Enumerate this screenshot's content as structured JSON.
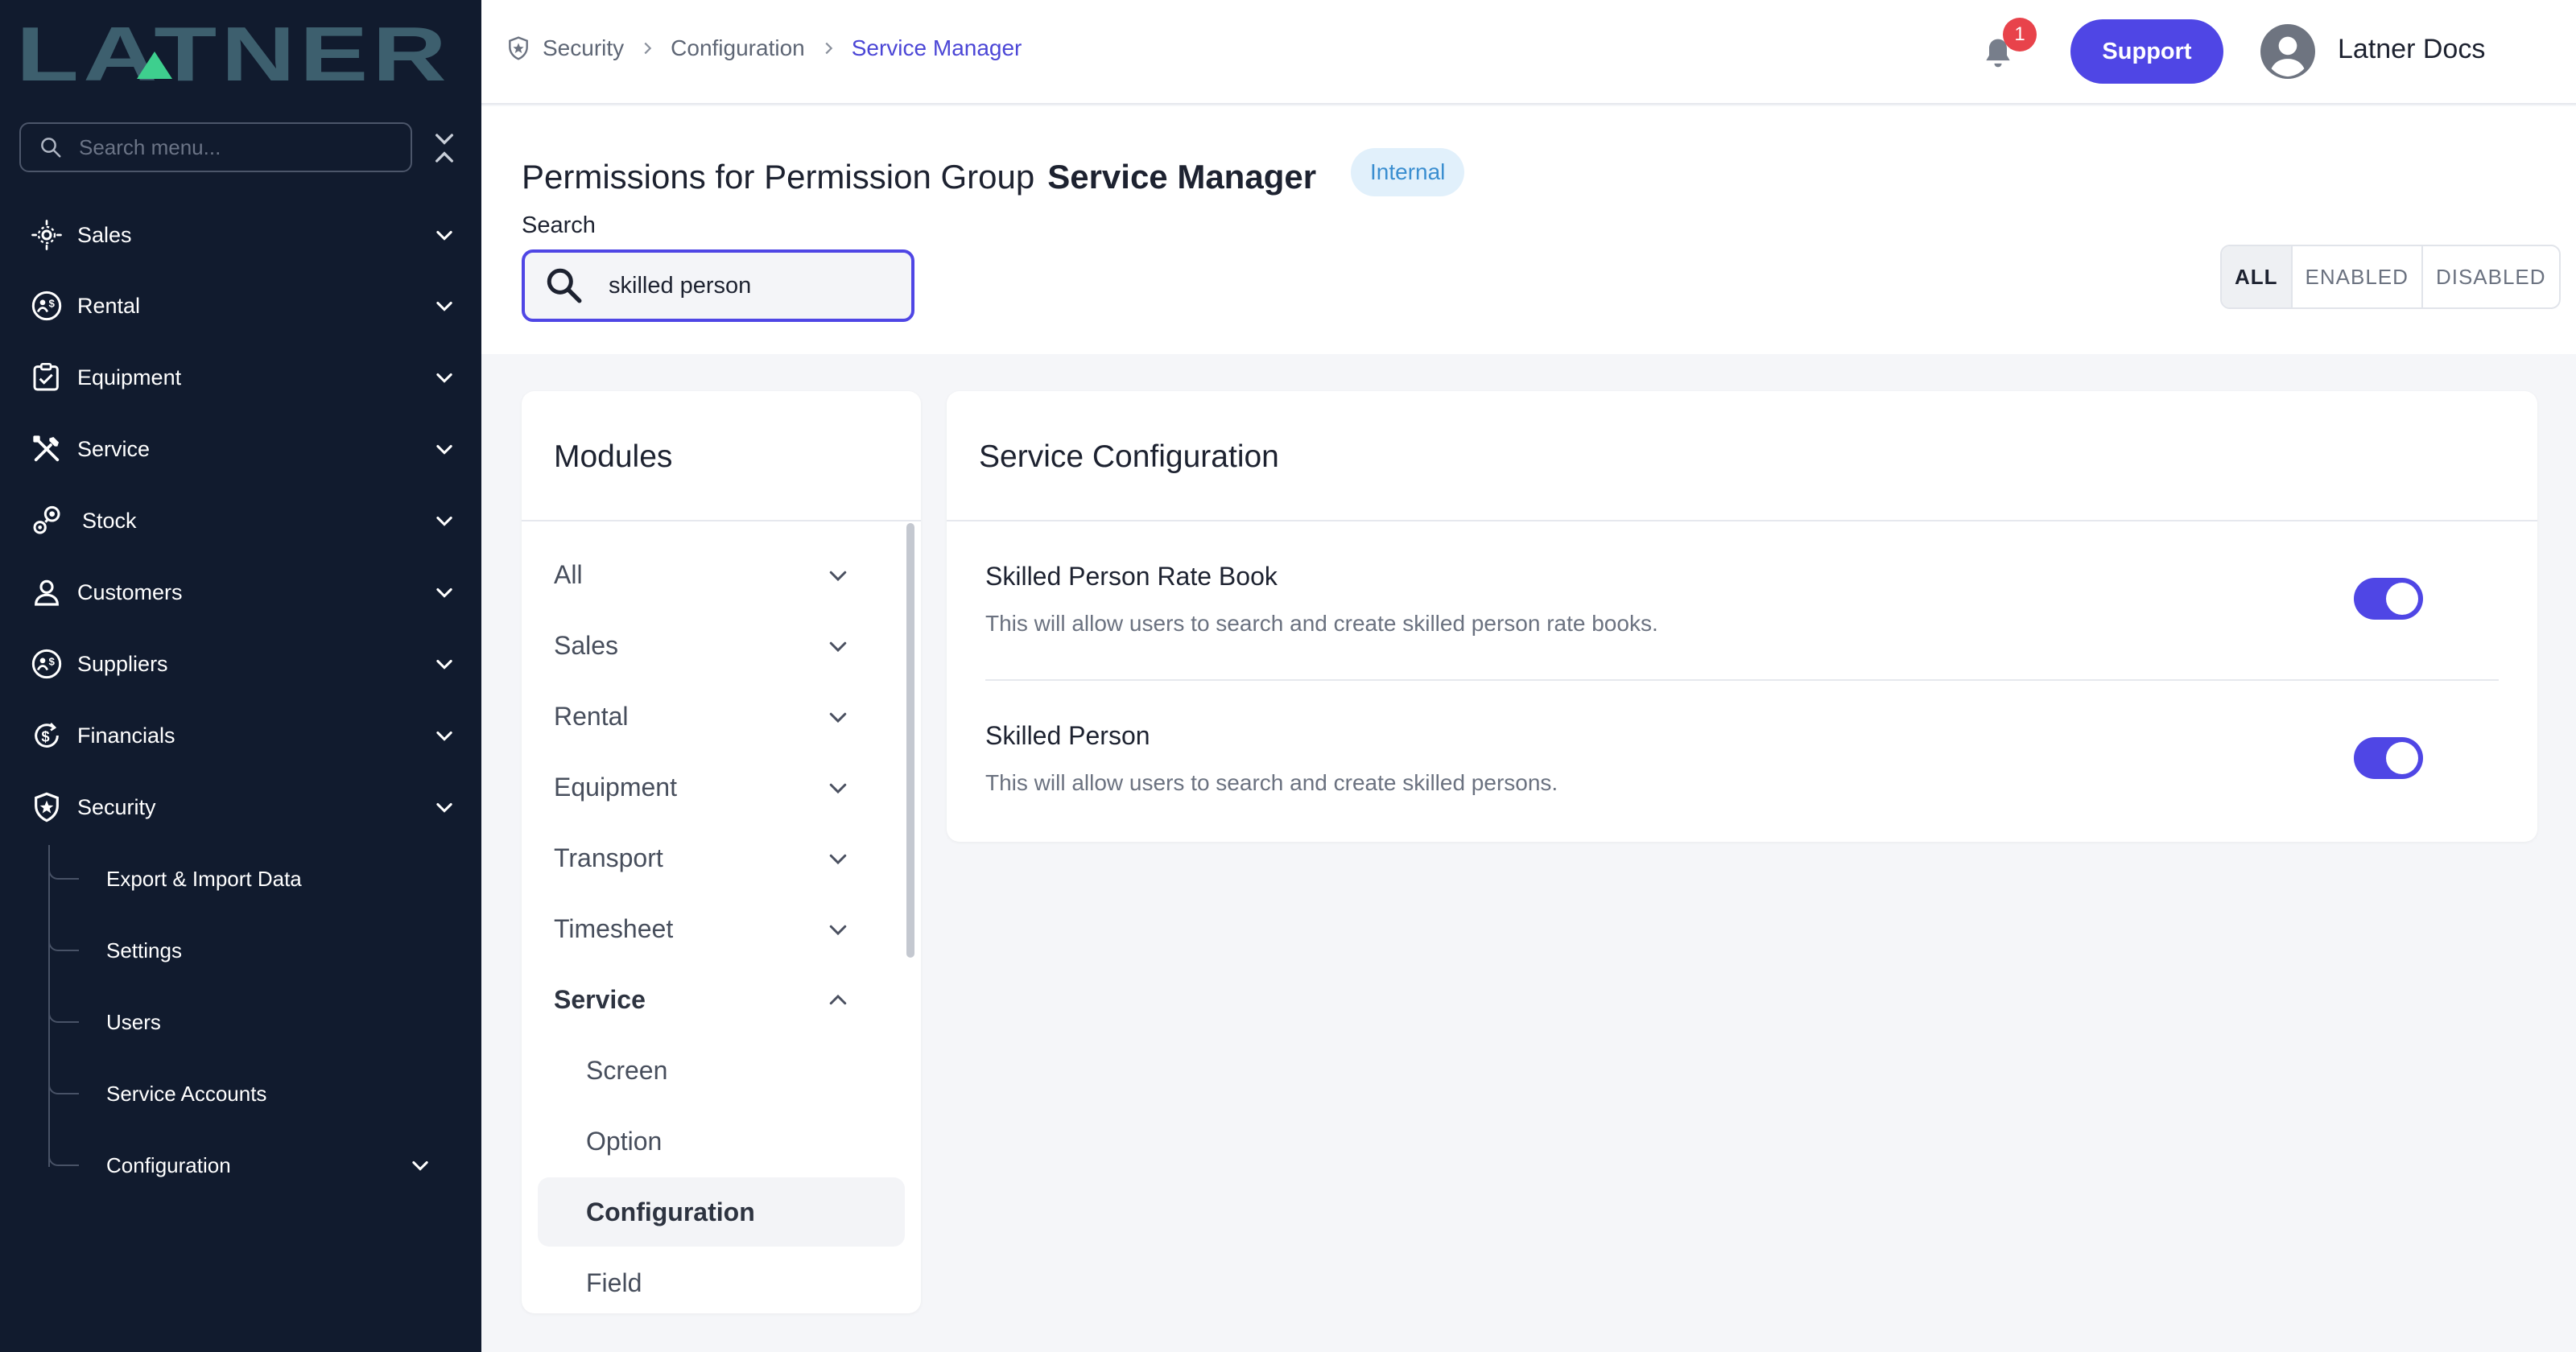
{
  "app": {
    "logo_text": "LATNER"
  },
  "sidebar": {
    "search_placeholder": "Search menu...",
    "items": [
      {
        "label": "Sales",
        "icon": "sales-icon"
      },
      {
        "label": "Rental",
        "icon": "rental-icon"
      },
      {
        "label": "Equipment",
        "icon": "equipment-icon"
      },
      {
        "label": "Service",
        "icon": "tools-icon"
      },
      {
        "label": "Stock",
        "icon": "stock-icon"
      },
      {
        "label": "Customers",
        "icon": "user-icon"
      },
      {
        "label": "Suppliers",
        "icon": "suppliers-icon"
      },
      {
        "label": "Financials",
        "icon": "dollar-icon"
      },
      {
        "label": "Security",
        "icon": "shield-icon"
      }
    ],
    "security_children": [
      {
        "label": "Export & Import Data"
      },
      {
        "label": "Settings"
      },
      {
        "label": "Users"
      },
      {
        "label": "Service Accounts"
      },
      {
        "label": "Configuration"
      }
    ]
  },
  "header": {
    "breadcrumb": [
      "Security",
      "Configuration",
      "Service Manager"
    ],
    "notification_count": "1",
    "support_label": "Support",
    "user_name": "Latner Docs"
  },
  "page": {
    "title_prefix": "Permissions for Permission Group",
    "group_name": "Service Manager",
    "tag": "Internal",
    "search_label": "Search",
    "search_value": "skilled person",
    "filters": [
      "ALL",
      "ENABLED",
      "DISABLED"
    ],
    "active_filter": "ALL"
  },
  "modules": {
    "title": "Modules",
    "items": [
      "All",
      "Sales",
      "Rental",
      "Equipment",
      "Transport",
      "Timesheet",
      "Service"
    ],
    "expanded": "Service",
    "service_children": [
      "Screen",
      "Option",
      "Configuration",
      "Field"
    ],
    "selected_child": "Configuration"
  },
  "config": {
    "title": "Service Configuration",
    "permissions": [
      {
        "name": "Skilled Person Rate Book",
        "description": "This will allow users to search and create skilled person rate books.",
        "enabled": true
      },
      {
        "name": "Skilled Person",
        "description": "This will allow users to search and create skilled persons.",
        "enabled": true
      }
    ]
  },
  "colors": {
    "accent": "#4f46e5",
    "sidebar_bg": "#111b2e",
    "badge": "#e8434b",
    "tag_bg": "#e1f0fb",
    "tag_text": "#3a8ed0",
    "logo": "#3d5f6e",
    "logo_accent": "#3ecf8e"
  }
}
